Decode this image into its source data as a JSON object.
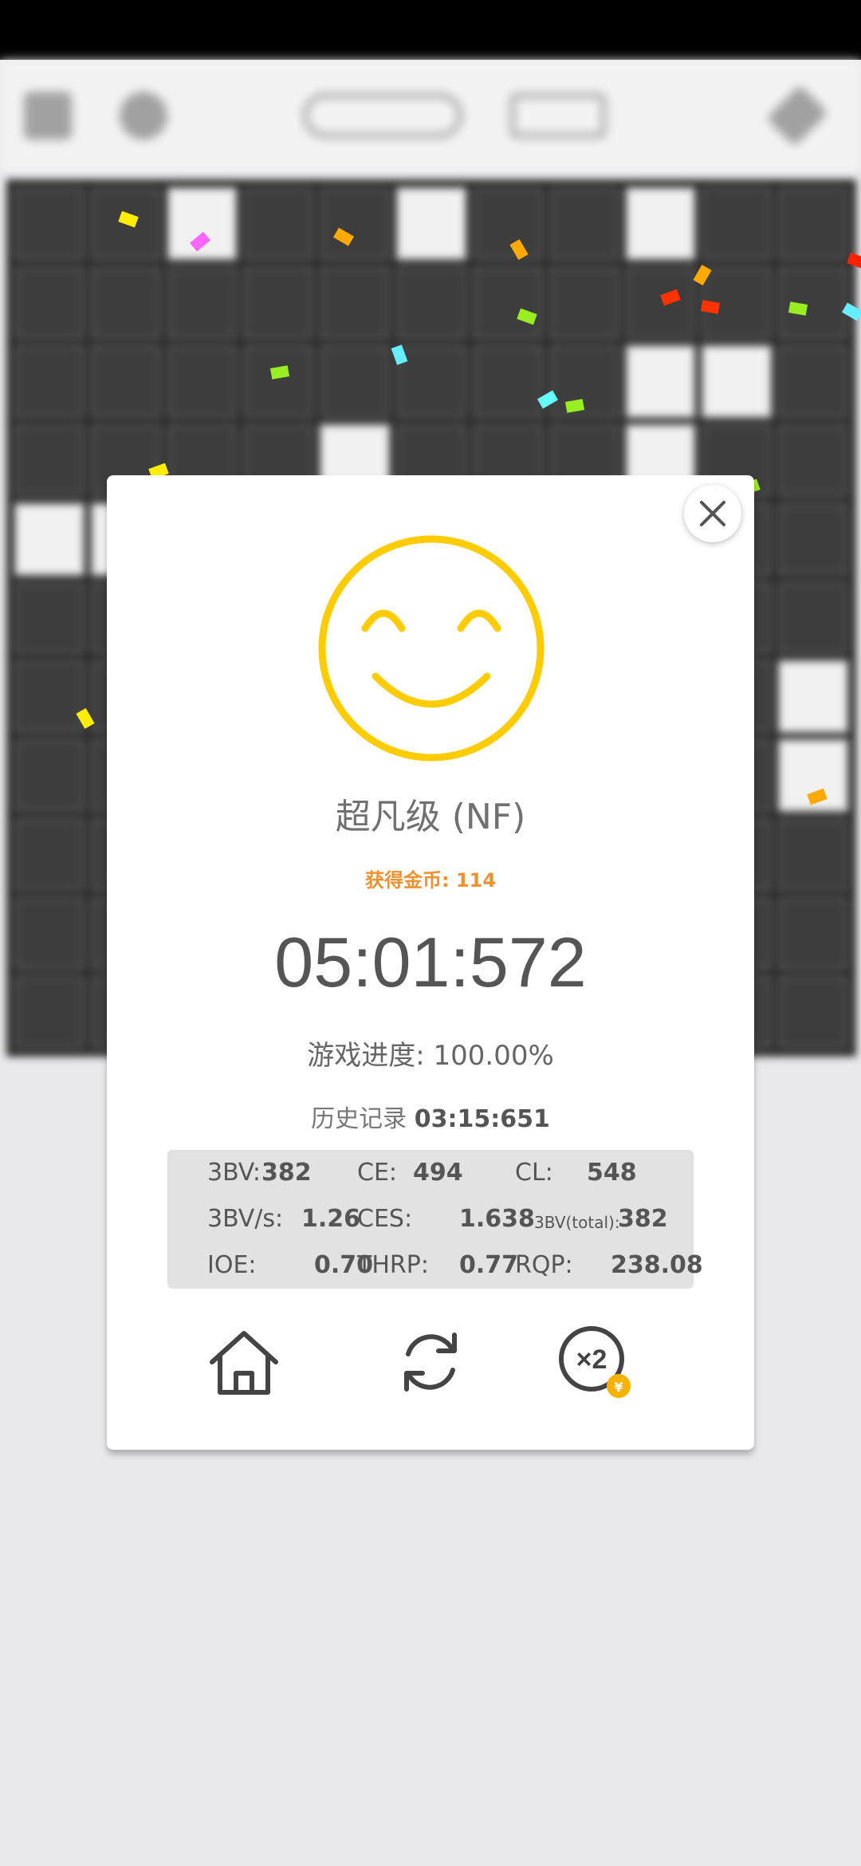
{
  "result": {
    "rank": "超凡级 (NF)",
    "coins_label": "获得金币:",
    "coins_value": "114",
    "time": "05:01:572",
    "progress_label": "游戏进度:",
    "progress_value": "100.00%",
    "history_label": "历史记录",
    "history_value": "03:15:651"
  },
  "stats": {
    "bv_label": "3BV:",
    "bv": "382",
    "ce_label": "CE:",
    "ce": "494",
    "cl_label": "CL:",
    "cl": "548",
    "bvs_label": "3BV/s:",
    "bvs": "1.26",
    "ces_label": "CES:",
    "ces": "1.638",
    "bvtotal_label": "3BV(total):",
    "bvtotal": "382",
    "ioe_label": "IOE:",
    "ioe": "0.70",
    "thrp_label": "THRP:",
    "thrp": "0.77",
    "rqp_label": "RQP:",
    "rqp": "238.08"
  },
  "icons": {
    "close": "close-icon",
    "smiley": "smiley-icon",
    "home": "home-icon",
    "restart": "restart-icon",
    "double": "double-reward-icon"
  },
  "colors": {
    "accent_yellow": "#ffcc00",
    "coin_orange": "#f0912f",
    "text_gray": "#555555"
  }
}
